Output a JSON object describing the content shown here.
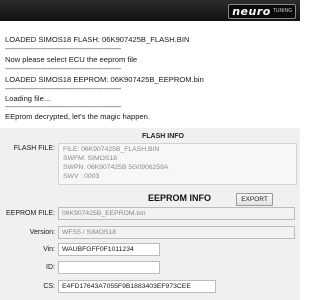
{
  "brand": {
    "name": "neuro",
    "sub": "TUNING"
  },
  "log": {
    "lines": [
      "LOADED SIMOS18 FLASH: 06K907425B_FLASH.BIN",
      "------------------------------------------------------------",
      "Now please select ECU the eeprom file",
      "------------------------------------------------------------",
      "LOADED SIMOS18 EEPROM: 06K907425B_EEPROM.bin",
      "------------------------------------------------------------",
      "Loading file...",
      "------------------------------------------------------------",
      "EEprom decrypted, let's the magic happen."
    ]
  },
  "flash_info": {
    "title": "FLASH INFO",
    "label": "FLASH FILE:",
    "lines": [
      "FILE: 06K907425B_FLASH.BIN",
      "SWFM:  SIMOS18",
      "SWPN:  06K907425B 5G0906259A",
      "SWV :  0003"
    ]
  },
  "eeprom_info": {
    "title": "EEPROM INFO",
    "export_label": "EXPORT",
    "fields": {
      "eeprom_file": {
        "label": "EEPROM FILE:",
        "value": "06K907425B_EEPROM.bin"
      },
      "version": {
        "label": "Version:",
        "value": "WFS5 / SIMOS18"
      },
      "vin": {
        "label": "Vin:",
        "value": "WAUBFGFF0F1011234"
      },
      "id": {
        "label": "ID:",
        "value": ""
      },
      "cs": {
        "label": "CS:",
        "value": "E4FD17643A7055F9B1883403EF973CEE"
      }
    }
  }
}
